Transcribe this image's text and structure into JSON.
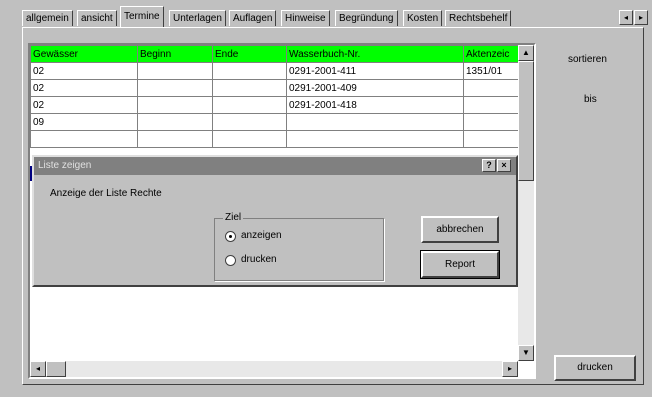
{
  "tabs": [
    {
      "label": "allgemein",
      "active": false
    },
    {
      "label": "ansicht",
      "active": false
    },
    {
      "label": "Termine",
      "active": true
    },
    {
      "label": "Unterlagen",
      "active": false
    },
    {
      "label": "Auflagen",
      "active": false
    },
    {
      "label": "Hinweise",
      "active": false
    },
    {
      "label": "Begründung",
      "active": false
    },
    {
      "label": "Kosten",
      "active": false
    },
    {
      "label": "Rechtsbehelf",
      "active": false
    }
  ],
  "tab_nav": {
    "prev": "◂",
    "next": "▸"
  },
  "grid": {
    "header_color": "#00ff00",
    "columns": [
      "Gewässer",
      "Beginn",
      "Ende",
      "Wasserbuch-Nr.",
      "Aktenzeic"
    ],
    "rows": [
      [
        "02",
        "",
        "",
        "0291-2001-411",
        "1351/01"
      ],
      [
        "02",
        "",
        "",
        "0291-2001-409",
        ""
      ],
      [
        "02",
        "",
        "",
        "0291-2001-418",
        ""
      ],
      [
        "09",
        "",
        "",
        "",
        ""
      ],
      [
        "",
        "",
        "",
        "",
        ""
      ]
    ]
  },
  "scroll": {
    "up": "▲",
    "down": "▼",
    "left": "◂",
    "right": "▸"
  },
  "right_panel": {
    "sort_label": "sortieren",
    "bis_label": "bis",
    "print_button": "drucken"
  },
  "dialog": {
    "title": "Liste zeigen",
    "help_button": "?",
    "close_button": "×",
    "message": "Anzeige der Liste Rechte",
    "group_label": "Ziel",
    "options": [
      {
        "label": "anzeigen",
        "checked": true
      },
      {
        "label": "drucken",
        "checked": false
      }
    ],
    "cancel_button": "abbrechen",
    "report_button": "Report"
  }
}
